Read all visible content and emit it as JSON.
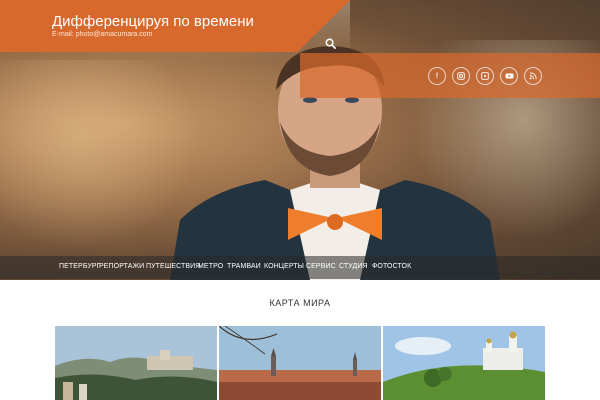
{
  "site": {
    "title": "Дифференцируя по времени",
    "email": "E-mail: photo@amacumara.com"
  },
  "header": {
    "search_icon": "search-icon",
    "social": [
      "facebook-icon",
      "instagram-icon",
      "flickr-icon",
      "youtube-icon",
      "rss-icon"
    ]
  },
  "nav": {
    "items": [
      {
        "label": "ПЕТЕРБУРГ"
      },
      {
        "label": "РЕПОРТАЖИ"
      },
      {
        "label": "ПУТЕШЕСТВИЯ"
      },
      {
        "label": "МЕТРО"
      },
      {
        "label": "ТРАМВАИ"
      },
      {
        "label": "КОНЦЕРТЫ"
      },
      {
        "label": "СЕРВИС"
      },
      {
        "label": "СТУДИЯ"
      },
      {
        "label": "ФОТОСТОК"
      }
    ]
  },
  "section": {
    "title": "КАРТА МИРА"
  },
  "colors": {
    "accent": "#d8692c",
    "nav_bg": "#3a3a3a",
    "text": "#333333"
  }
}
